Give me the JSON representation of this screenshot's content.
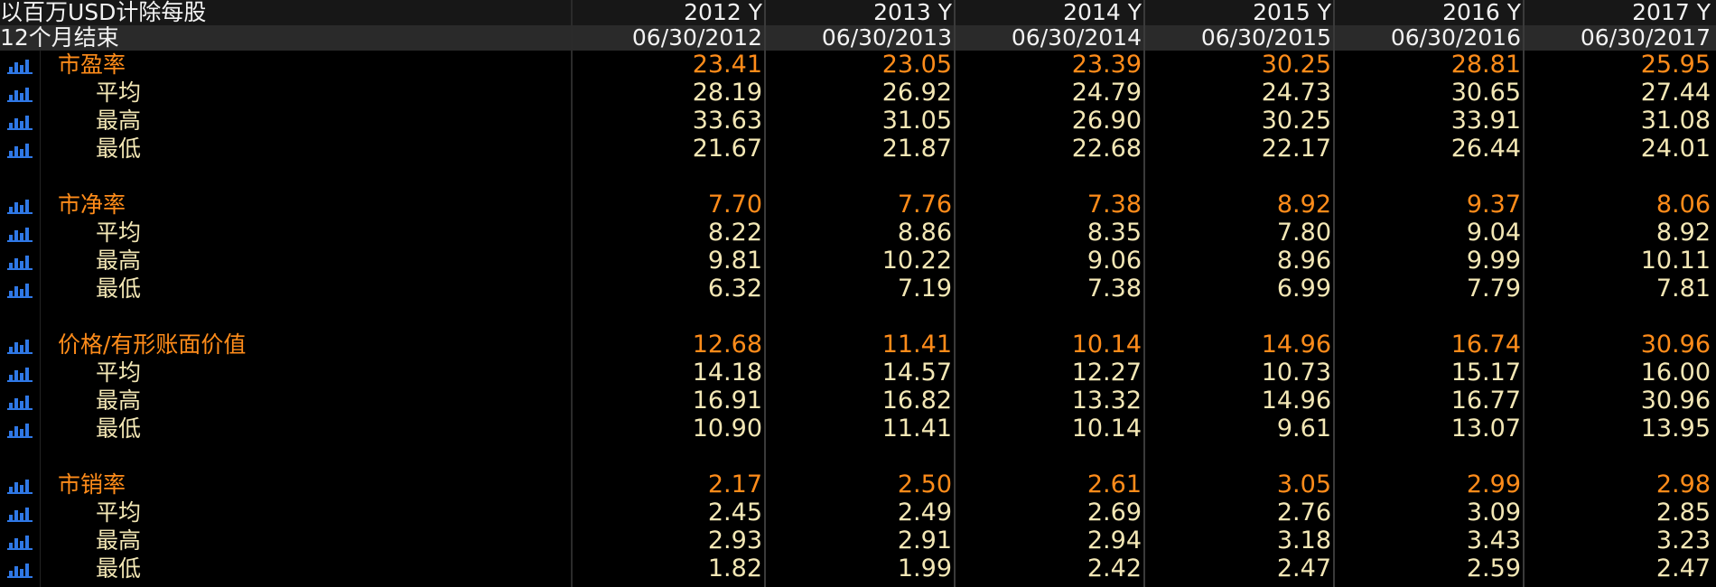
{
  "header": {
    "currency_label": "以百万USD计除每股",
    "period_label": "12个月结束",
    "years": [
      "2012 Y",
      "2013 Y",
      "2014 Y",
      "2015 Y",
      "2016 Y",
      "2017 Y"
    ],
    "dates": [
      "06/30/2012",
      "06/30/2013",
      "06/30/2014",
      "06/30/2015",
      "06/30/2016",
      "06/30/2017"
    ]
  },
  "sections": [
    {
      "label": "市盈率",
      "values": [
        "23.41",
        "23.05",
        "23.39",
        "30.25",
        "28.81",
        "25.95"
      ],
      "subs": [
        {
          "label": "平均",
          "values": [
            "28.19",
            "26.92",
            "24.79",
            "24.73",
            "30.65",
            "27.44"
          ]
        },
        {
          "label": "最高",
          "values": [
            "33.63",
            "31.05",
            "26.90",
            "30.25",
            "33.91",
            "31.08"
          ]
        },
        {
          "label": "最低",
          "values": [
            "21.67",
            "21.87",
            "22.68",
            "22.17",
            "26.44",
            "24.01"
          ]
        }
      ]
    },
    {
      "label": "市净率",
      "values": [
        "7.70",
        "7.76",
        "7.38",
        "8.92",
        "9.37",
        "8.06"
      ],
      "subs": [
        {
          "label": "平均",
          "values": [
            "8.22",
            "8.86",
            "8.35",
            "7.80",
            "9.04",
            "8.92"
          ]
        },
        {
          "label": "最高",
          "values": [
            "9.81",
            "10.22",
            "9.06",
            "8.96",
            "9.99",
            "10.11"
          ]
        },
        {
          "label": "最低",
          "values": [
            "6.32",
            "7.19",
            "7.38",
            "6.99",
            "7.79",
            "7.81"
          ]
        }
      ]
    },
    {
      "label": "价格/有形账面价值",
      "values": [
        "12.68",
        "11.41",
        "10.14",
        "14.96",
        "16.74",
        "30.96"
      ],
      "subs": [
        {
          "label": "平均",
          "values": [
            "14.18",
            "14.57",
            "12.27",
            "10.73",
            "15.17",
            "16.00"
          ]
        },
        {
          "label": "最高",
          "values": [
            "16.91",
            "16.82",
            "13.32",
            "14.96",
            "16.77",
            "30.96"
          ]
        },
        {
          "label": "最低",
          "values": [
            "10.90",
            "11.41",
            "10.14",
            "9.61",
            "13.07",
            "13.95"
          ]
        }
      ]
    },
    {
      "label": "市销率",
      "values": [
        "2.17",
        "2.50",
        "2.61",
        "3.05",
        "2.99",
        "2.98"
      ],
      "subs": [
        {
          "label": "平均",
          "values": [
            "2.45",
            "2.49",
            "2.69",
            "2.76",
            "3.09",
            "2.85"
          ]
        },
        {
          "label": "最高",
          "values": [
            "2.93",
            "2.91",
            "2.94",
            "3.18",
            "3.43",
            "3.23"
          ]
        },
        {
          "label": "最低",
          "values": [
            "1.82",
            "1.99",
            "2.42",
            "2.47",
            "2.59",
            "2.47"
          ]
        }
      ]
    }
  ],
  "colors": {
    "main_label": "#ff8c1a",
    "sub_label": "#f3e7b5",
    "icon": "#2f78e6",
    "background": "#000000"
  },
  "icon_name": "bar-chart-icon"
}
